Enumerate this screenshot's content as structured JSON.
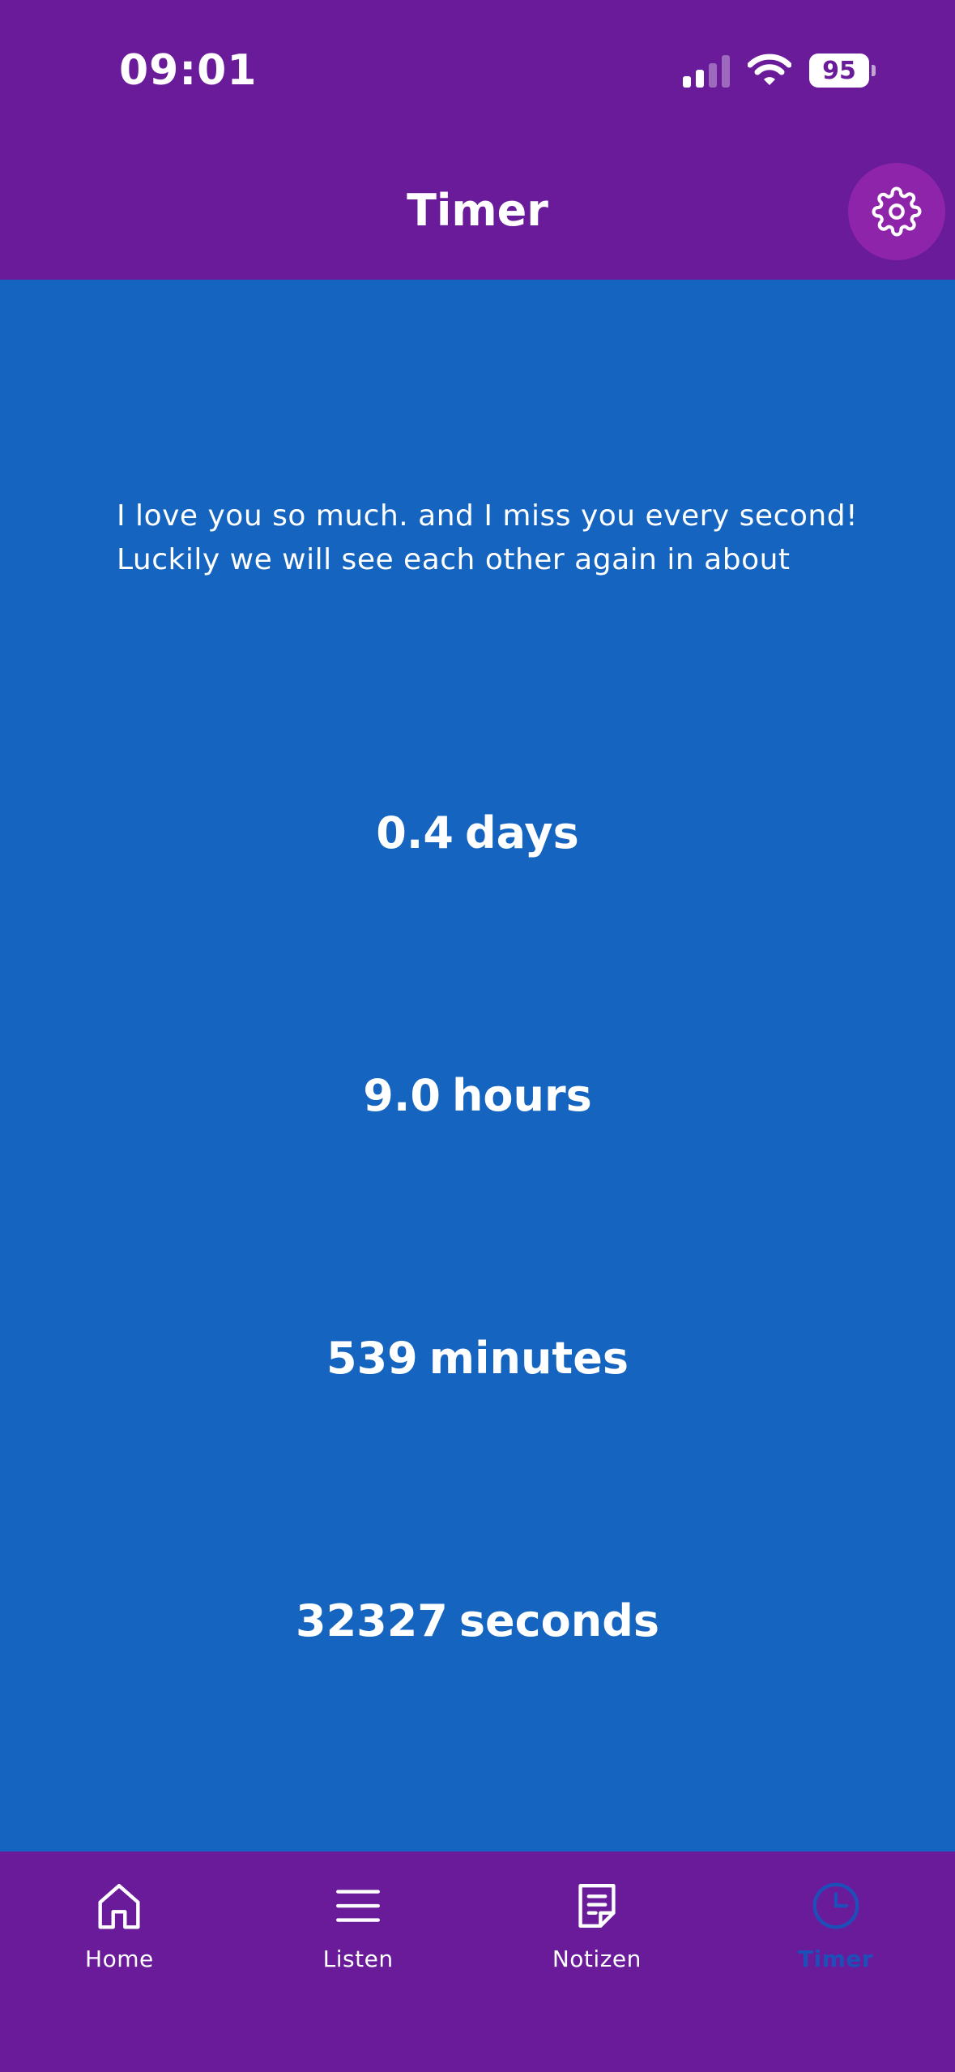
{
  "status_bar": {
    "time": "09:01",
    "battery": "95",
    "signal_icon": "signal-bars-icon",
    "wifi_icon": "wifi-icon"
  },
  "app_bar": {
    "title": "Timer",
    "settings_icon": "gear-icon"
  },
  "message": {
    "line1": "I love you so much. and I miss you every second!",
    "line2": "Luckily we will see each other again in about"
  },
  "counters": [
    {
      "value": "0.4",
      "unit": "days"
    },
    {
      "value": "9.0",
      "unit": "hours"
    },
    {
      "value": "539",
      "unit": "minutes"
    },
    {
      "value": "32327",
      "unit": "seconds"
    }
  ],
  "bottom_nav": {
    "items": [
      {
        "label": "Home",
        "icon": "home-icon",
        "active": false
      },
      {
        "label": "Listen",
        "icon": "list-icon",
        "active": false
      },
      {
        "label": "Notizen",
        "icon": "note-icon",
        "active": false
      },
      {
        "label": "Timer",
        "icon": "clock-icon",
        "active": true
      }
    ]
  },
  "colors": {
    "primary_purple": "#6A1B9A",
    "settings_button": "#8E24AA",
    "background_blue": "#1565C0",
    "active_nav": "#1E4FB8",
    "text": "#FFFFFF"
  }
}
